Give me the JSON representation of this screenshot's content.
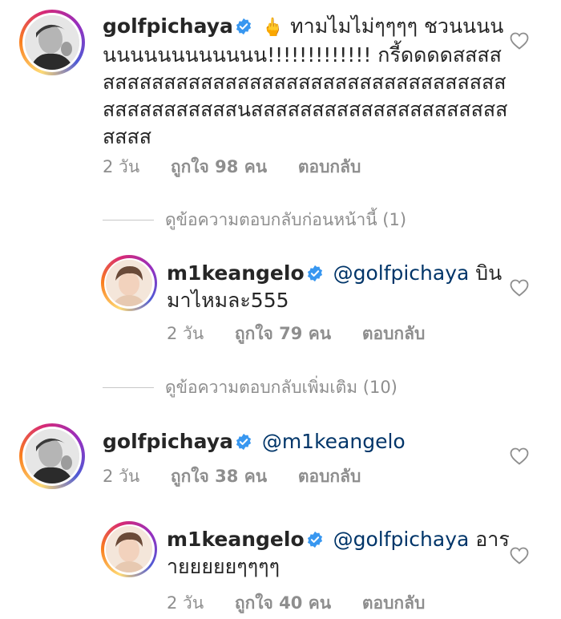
{
  "comments": [
    {
      "username": "golfpichaya",
      "emoji": "🖕",
      "text_first": " ทามไมไม่ๆๆๆๆ ชวนนนนนนนนนนนนนนนน!!!!!!!!!!!!! กรี้ดดดดสสสสสสสสสสสสสสสสสสสสสสสสสสสสสสสสสสสสสสสสสสสสสสสสนสสสสสสสสสสสสสสสสสสสสสสสสส",
      "time": "2 วัน",
      "likes": "ถูกใจ 98 คน",
      "reply": "ตอบกลับ"
    },
    {
      "username": "m1keangelo",
      "mention": "@golfpichaya",
      "text": " บินมาไหมละ555",
      "time": "2 วัน",
      "likes": "ถูกใจ 79 คน",
      "reply": "ตอบกลับ"
    },
    {
      "username": "golfpichaya",
      "mention": "@m1keangelo",
      "text": "",
      "time": "2 วัน",
      "likes": "ถูกใจ 38 คน",
      "reply": "ตอบกลับ"
    },
    {
      "username": "m1keangelo",
      "mention": "@golfpichaya",
      "text": " อารายยยยยๆๆๆๆ",
      "time": "2 วัน",
      "likes": "ถูกใจ 40 คน",
      "reply": "ตอบกลับ"
    }
  ],
  "view_previous_replies": "ดูข้อความตอบกลับก่อนหน้านี้ (1)",
  "view_more_replies": "ดูข้อความตอบกลับเพิ่มเติม (10)",
  "icons": {
    "verified": "verified-badge-icon",
    "like": "heart-outline-icon"
  },
  "colors": {
    "verified_blue": "#3897f0",
    "mention": "#003569",
    "meta_gray": "#8e8e8e"
  }
}
